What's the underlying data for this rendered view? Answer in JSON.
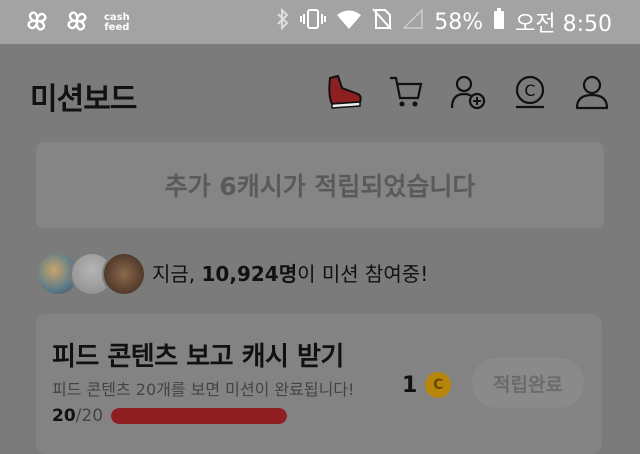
{
  "status_bar": {
    "app_badge": "cash\nfeed",
    "battery": "58%",
    "time": "오전 8:50"
  },
  "header": {
    "title": "미션보드",
    "icons": [
      "sneaker-icon",
      "cart-icon",
      "add-user-icon",
      "cash-coin-icon",
      "profile-icon"
    ]
  },
  "banner": {
    "text": "추가 6캐시가 적립되었습니다"
  },
  "participants": {
    "prefix": "지금, ",
    "count": "10,924명",
    "suffix": "이 미션 참여중!"
  },
  "mission": {
    "title": "피드 콘텐츠 보고 캐시 받기",
    "subtitle": "피드 콘텐츠 20개를 보면 미션이 완료됩니다!",
    "reward": "1",
    "coin_symbol": "C",
    "button": "적립완료",
    "progress_current": "20",
    "progress_total": "/20",
    "progress_fraction": 1.0
  },
  "colors": {
    "accent": "#8e1f20",
    "coin": "#b8860b"
  }
}
